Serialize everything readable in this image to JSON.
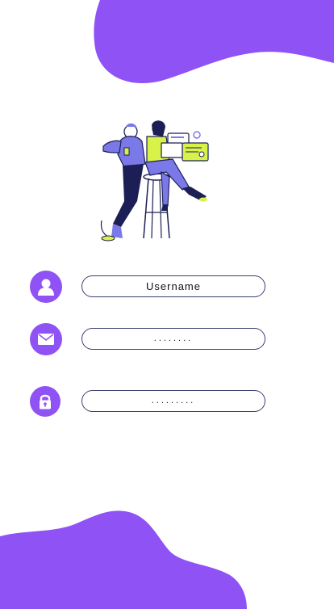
{
  "colors": {
    "accent": "#8e52f5",
    "field_border": "#3b3f6b",
    "illustration_lime": "#d9f24a",
    "illustration_navy": "#1c1f55",
    "illustration_periwinkle": "#7b78e8"
  },
  "form": {
    "username_value": "Username",
    "email_value": "........",
    "password_value": "........."
  },
  "icons": {
    "username": "user-icon",
    "email": "envelope-icon",
    "password": "lock-icon"
  }
}
